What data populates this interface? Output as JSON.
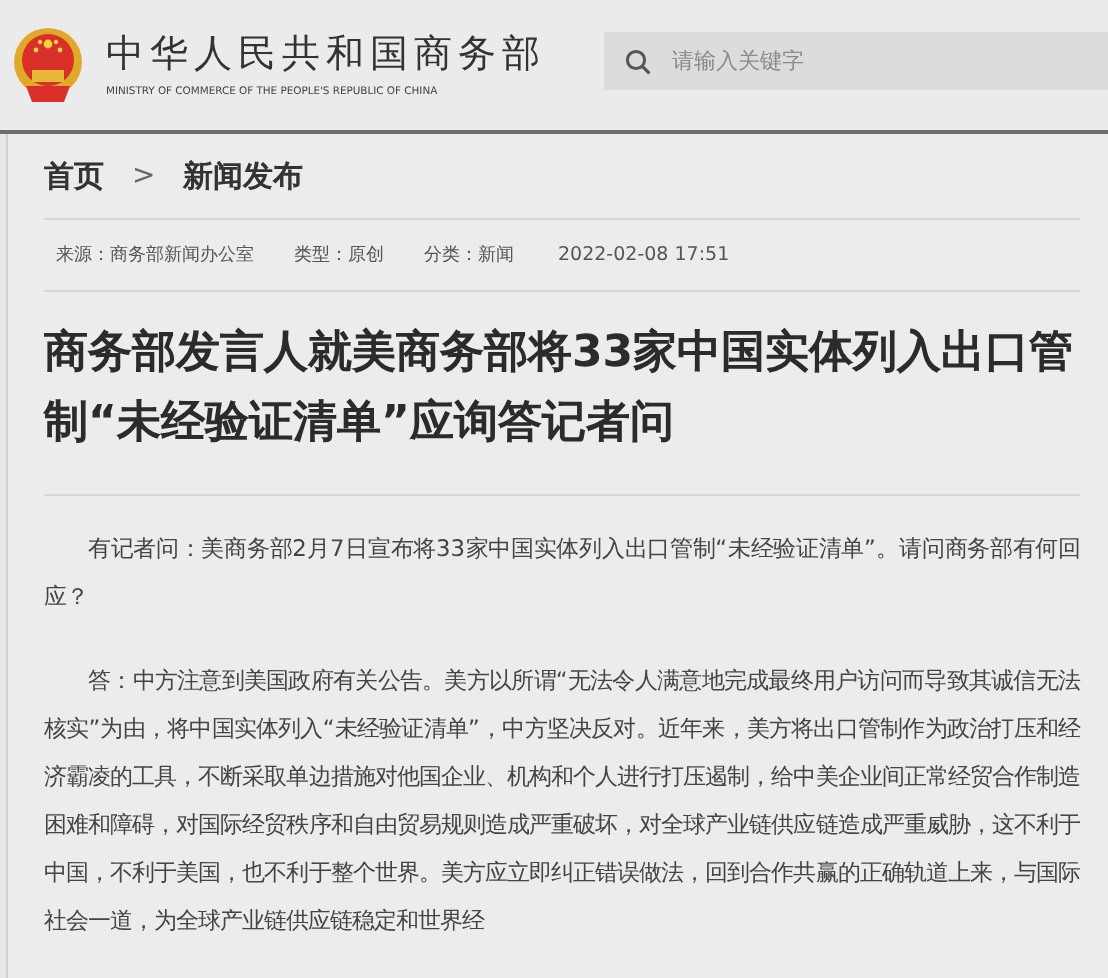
{
  "header": {
    "site_name": "中华人民共和国商务部",
    "site_name_en": "MINISTRY OF COMMERCE OF THE PEOPLE'S REPUBLIC OF CHINA",
    "search": {
      "placeholder": "请输入关键字"
    }
  },
  "breadcrumb": [
    {
      "label": "首页"
    },
    {
      "label": "新闻发布"
    }
  ],
  "breadcrumb_separator": ">",
  "meta": [
    {
      "label": "来源：商务部新闻办公室"
    },
    {
      "label": "类型：原创"
    },
    {
      "label": "分类：新闻"
    },
    {
      "label": "2022-02-08 17:51"
    }
  ],
  "article": {
    "title": "商务部发言人就美商务部将33家中国实体列入出口管制“未经验证清单”应询答记者问",
    "paragraphs": [
      "有记者问：美商务部2月7日宣布将33家中国实体列入出口管制“未经验证清单”。请问商务部有何回应？",
      "答：中方注意到美国政府有关公告。美方以所谓“无法令人满意地完成最终用户访问而导致其诚信无法核实”为由，将中国实体列入“未经验证清单”，中方坚决反对。近年来，美方将出口管制作为政治打压和经济霸凌的工具，不断采取单边措施对他国企业、机构和个人进行打压遏制，给中美企业间正常经贸合作制造困难和障碍，对国际经贸秩序和自由贸易规则造成严重破坏，对全球产业链供应链造成严重威胁，这不利于中国，不利于美国，也不利于整个世界。美方应立即纠正错误做法，回到合作共赢的正确轨道上来，与国际社会一道，为全球产业链供应链稳定和世界经"
    ]
  }
}
